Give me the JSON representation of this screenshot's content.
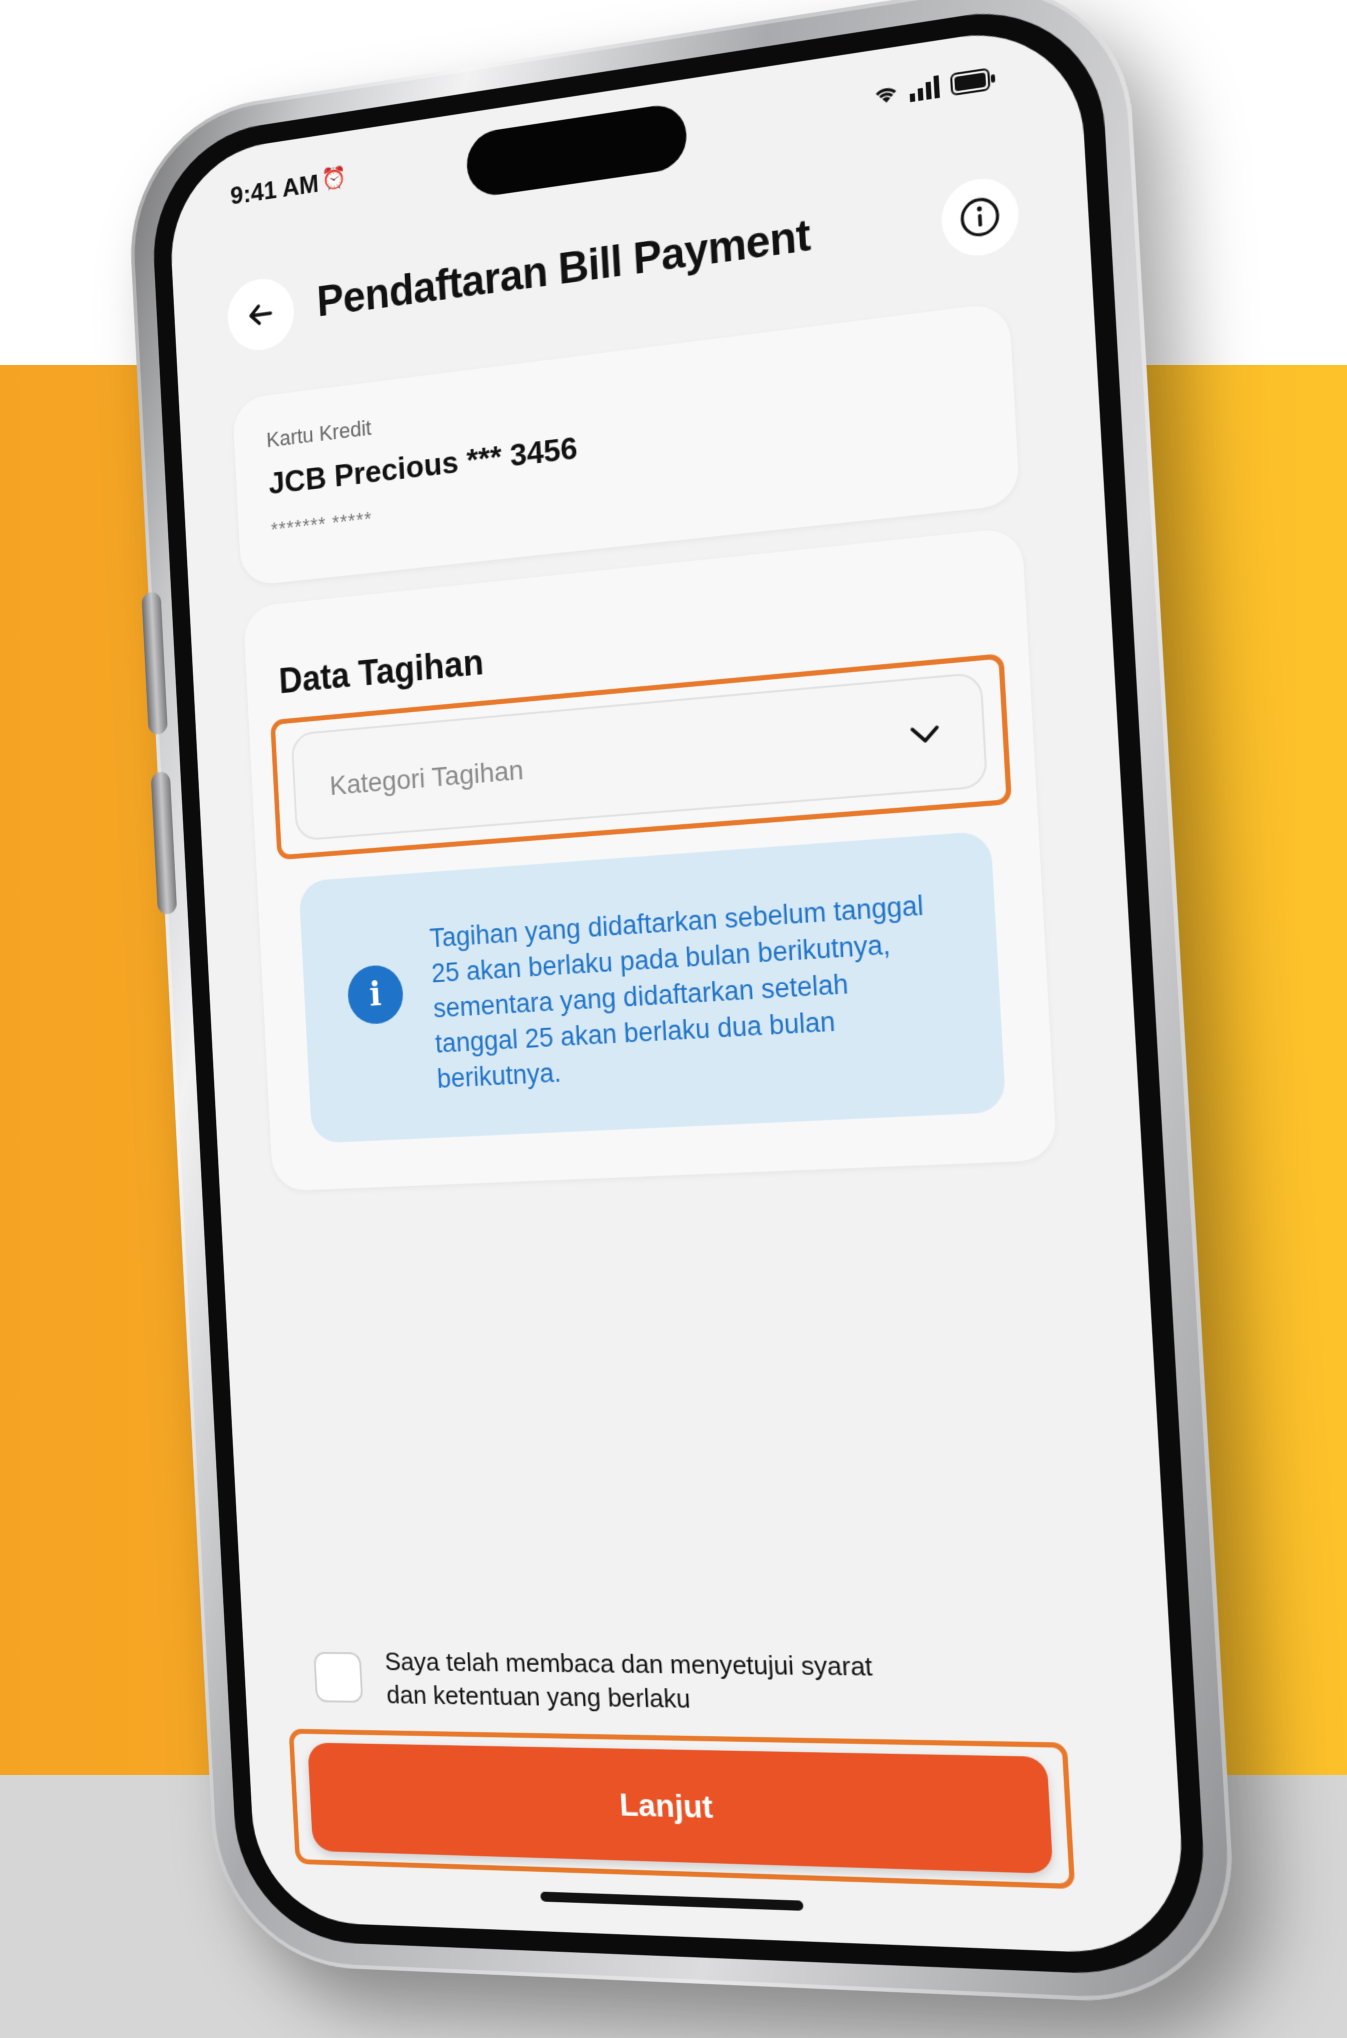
{
  "status": {
    "time": "9:41 AM",
    "alarm_icon": "alarm-icon",
    "wifi_icon": "wifi-icon",
    "signal_icon": "signal-icon",
    "battery_icon": "battery-icon"
  },
  "header": {
    "back_icon": "arrow-left-icon",
    "title": "Pendaftaran Bill Payment",
    "info_icon": "info-icon"
  },
  "account": {
    "label": "Kartu Kredit",
    "name": "JCB Precious *** 3456",
    "masked_number": "******* *****"
  },
  "bill": {
    "title": "Data Tagihan",
    "category_placeholder": "Kategori Tagihan",
    "category_icon": "chevron-down-icon",
    "info_icon": "info-icon",
    "info_text": "Tagihan yang didaftarkan sebelum tanggal 25 akan berlaku pada bulan berikutnya, sementara yang didaftarkan setelah tanggal 25 akan berlaku dua bulan berikutnya."
  },
  "agreement": {
    "text": "Saya telah membaca dan menyetujui syarat dan ketentuan yang berlaku",
    "checked": false
  },
  "actions": {
    "next_label": "Lanjut"
  },
  "colors": {
    "accent": "#e95325",
    "highlight": "#e8782a",
    "info_blue": "#1f73c8",
    "info_bg": "#d8e9f6",
    "background_orange": "#f8b125"
  }
}
